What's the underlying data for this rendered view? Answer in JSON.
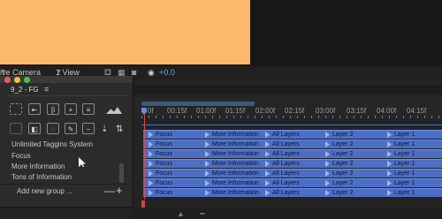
{
  "viewer": {
    "camera_label": "ive Camera",
    "view_label": "1 View",
    "exposure_value": "+0.0"
  },
  "panel": {
    "title": "9_2 - FG",
    "menu_glyph": "≡",
    "tags": [
      "Unlimited Taggins System",
      "Focus",
      "More Information",
      "Tons of Information"
    ],
    "add_group_label": "Add new group ...",
    "minus_label": "—",
    "plus_label": "+"
  },
  "timeline": {
    "ruler_labels": [
      "0f",
      "00:15f",
      "01:00f",
      "01:15f",
      "02:00f",
      "02:15f",
      "03:00f",
      "03:15f",
      "04:00f",
      "04:15f"
    ],
    "layer_rows": [
      [
        "Focus",
        "More Information",
        "All Layers",
        "Layer 2",
        "Layer 1"
      ],
      [
        "Focus",
        "More Information",
        "All Layers",
        "Layer 2",
        "Layer 1"
      ],
      [
        "Focus",
        "More Information",
        "All Layers",
        "Layer 2",
        "Layer 1"
      ],
      [
        "Focus",
        "More Information",
        "All Layers",
        "Layer 2",
        "Layer 1"
      ],
      [
        "Focus",
        "More Information",
        "All Layers",
        "Layer 2",
        "Layer 1"
      ],
      [
        "Focus",
        "More Information",
        "All Layers",
        "Layer 2",
        "Layer 1"
      ],
      [
        "Focus",
        "More Information",
        "All Layers",
        "Layer 2",
        "Layer 1"
      ]
    ]
  },
  "colors": {
    "comp_background": "#fcb96e",
    "layer_bar": "#4c6ec5",
    "playhead": "#d94a4a"
  }
}
